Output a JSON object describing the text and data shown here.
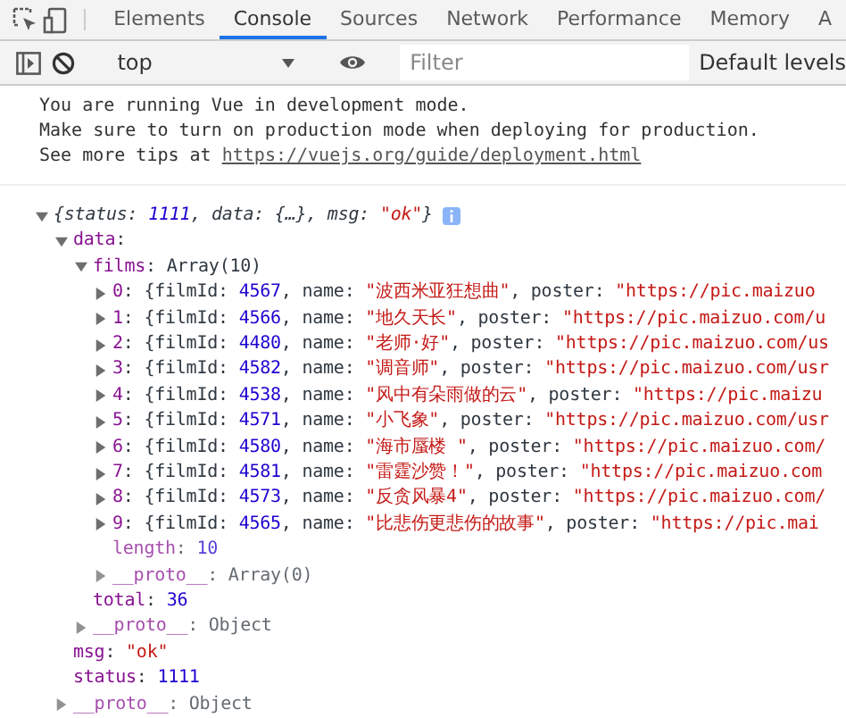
{
  "tabs": [
    {
      "label": "Elements",
      "selected": false
    },
    {
      "label": "Console",
      "selected": true
    },
    {
      "label": "Sources",
      "selected": false
    },
    {
      "label": "Network",
      "selected": false
    },
    {
      "label": "Performance",
      "selected": false
    },
    {
      "label": "Memory",
      "selected": false
    },
    {
      "label": "A",
      "selected": false
    }
  ],
  "toolbar": {
    "context": "top",
    "filter": {
      "placeholder": "Filter"
    },
    "levels": "Default levels"
  },
  "messages": [
    {
      "text": "You are running Vue in development mode."
    },
    {
      "text": "Make sure to turn on production mode when deploying for production."
    },
    {
      "text": "See more tips at ",
      "link": "https://vuejs.org/guide/deployment.html"
    }
  ],
  "tree": {
    "expanded": true,
    "italic": true,
    "info": true,
    "segments": [
      {
        "kind": "punct",
        "text": "{status: "
      },
      {
        "kind": "number",
        "text": "1111"
      },
      {
        "kind": "punct",
        "text": ", data: {…}, msg: "
      },
      {
        "kind": "string",
        "text": "\"ok\""
      },
      {
        "kind": "punct",
        "text": "}"
      }
    ],
    "children": [
      {
        "expanded": true,
        "segments": [
          {
            "kind": "key",
            "text": "data"
          },
          {
            "kind": "punct",
            "text": ":"
          }
        ],
        "children": [
          {
            "expanded": true,
            "segments": [
              {
                "kind": "key",
                "text": "films"
              },
              {
                "kind": "punct",
                "text": ": Array(10)"
              }
            ],
            "children": [
              {
                "expanded": false,
                "segments": [
                  {
                    "kind": "key",
                    "text": "0"
                  },
                  {
                    "kind": "punct",
                    "text": ": {filmId: "
                  },
                  {
                    "kind": "number",
                    "text": "4567"
                  },
                  {
                    "kind": "punct",
                    "text": ", name: "
                  },
                  {
                    "kind": "string",
                    "text": "\"波西米亚狂想曲\""
                  },
                  {
                    "kind": "punct",
                    "text": ", poster: "
                  },
                  {
                    "kind": "string",
                    "text": "\"https://pic.maizuo"
                  }
                ]
              },
              {
                "expanded": false,
                "segments": [
                  {
                    "kind": "key",
                    "text": "1"
                  },
                  {
                    "kind": "punct",
                    "text": ": {filmId: "
                  },
                  {
                    "kind": "number",
                    "text": "4566"
                  },
                  {
                    "kind": "punct",
                    "text": ", name: "
                  },
                  {
                    "kind": "string",
                    "text": "\"地久天长\""
                  },
                  {
                    "kind": "punct",
                    "text": ", poster: "
                  },
                  {
                    "kind": "string",
                    "text": "\"https://pic.maizuo.com/u"
                  }
                ]
              },
              {
                "expanded": false,
                "segments": [
                  {
                    "kind": "key",
                    "text": "2"
                  },
                  {
                    "kind": "punct",
                    "text": ": {filmId: "
                  },
                  {
                    "kind": "number",
                    "text": "4480"
                  },
                  {
                    "kind": "punct",
                    "text": ", name: "
                  },
                  {
                    "kind": "string",
                    "text": "\"老师·好\""
                  },
                  {
                    "kind": "punct",
                    "text": ", poster: "
                  },
                  {
                    "kind": "string",
                    "text": "\"https://pic.maizuo.com/us"
                  }
                ]
              },
              {
                "expanded": false,
                "segments": [
                  {
                    "kind": "key",
                    "text": "3"
                  },
                  {
                    "kind": "punct",
                    "text": ": {filmId: "
                  },
                  {
                    "kind": "number",
                    "text": "4582"
                  },
                  {
                    "kind": "punct",
                    "text": ", name: "
                  },
                  {
                    "kind": "string",
                    "text": "\"调音师\""
                  },
                  {
                    "kind": "punct",
                    "text": ", poster: "
                  },
                  {
                    "kind": "string",
                    "text": "\"https://pic.maizuo.com/usr"
                  }
                ]
              },
              {
                "expanded": false,
                "segments": [
                  {
                    "kind": "key",
                    "text": "4"
                  },
                  {
                    "kind": "punct",
                    "text": ": {filmId: "
                  },
                  {
                    "kind": "number",
                    "text": "4538"
                  },
                  {
                    "kind": "punct",
                    "text": ", name: "
                  },
                  {
                    "kind": "string",
                    "text": "\"风中有朵雨做的云\""
                  },
                  {
                    "kind": "punct",
                    "text": ", poster: "
                  },
                  {
                    "kind": "string",
                    "text": "\"https://pic.maizu"
                  }
                ]
              },
              {
                "expanded": false,
                "segments": [
                  {
                    "kind": "key",
                    "text": "5"
                  },
                  {
                    "kind": "punct",
                    "text": ": {filmId: "
                  },
                  {
                    "kind": "number",
                    "text": "4571"
                  },
                  {
                    "kind": "punct",
                    "text": ", name: "
                  },
                  {
                    "kind": "string",
                    "text": "\"小飞象\""
                  },
                  {
                    "kind": "punct",
                    "text": ", poster: "
                  },
                  {
                    "kind": "string",
                    "text": "\"https://pic.maizuo.com/usr"
                  }
                ]
              },
              {
                "expanded": false,
                "segments": [
                  {
                    "kind": "key",
                    "text": "6"
                  },
                  {
                    "kind": "punct",
                    "text": ": {filmId: "
                  },
                  {
                    "kind": "number",
                    "text": "4580"
                  },
                  {
                    "kind": "punct",
                    "text": ", name: "
                  },
                  {
                    "kind": "string",
                    "text": "\"海市蜃楼 \""
                  },
                  {
                    "kind": "punct",
                    "text": ", poster: "
                  },
                  {
                    "kind": "string",
                    "text": "\"https://pic.maizuo.com/"
                  }
                ]
              },
              {
                "expanded": false,
                "segments": [
                  {
                    "kind": "key",
                    "text": "7"
                  },
                  {
                    "kind": "punct",
                    "text": ": {filmId: "
                  },
                  {
                    "kind": "number",
                    "text": "4581"
                  },
                  {
                    "kind": "punct",
                    "text": ", name: "
                  },
                  {
                    "kind": "string",
                    "text": "\"雷霆沙赞！\""
                  },
                  {
                    "kind": "punct",
                    "text": ", poster: "
                  },
                  {
                    "kind": "string",
                    "text": "\"https://pic.maizuo.com"
                  }
                ]
              },
              {
                "expanded": false,
                "segments": [
                  {
                    "kind": "key",
                    "text": "8"
                  },
                  {
                    "kind": "punct",
                    "text": ": {filmId: "
                  },
                  {
                    "kind": "number",
                    "text": "4573"
                  },
                  {
                    "kind": "punct",
                    "text": ", name: "
                  },
                  {
                    "kind": "string",
                    "text": "\"反贪风暴4\""
                  },
                  {
                    "kind": "punct",
                    "text": ", poster: "
                  },
                  {
                    "kind": "string",
                    "text": "\"https://pic.maizuo.com/"
                  }
                ]
              },
              {
                "expanded": false,
                "segments": [
                  {
                    "kind": "key",
                    "text": "9"
                  },
                  {
                    "kind": "punct",
                    "text": ": {filmId: "
                  },
                  {
                    "kind": "number",
                    "text": "4565"
                  },
                  {
                    "kind": "punct",
                    "text": ", name: "
                  },
                  {
                    "kind": "string",
                    "text": "\"比悲伤更悲伤的故事\""
                  },
                  {
                    "kind": "punct",
                    "text": ", poster: "
                  },
                  {
                    "kind": "string",
                    "text": "\"https://pic.mai"
                  }
                ]
              },
              {
                "dim": true,
                "segments": [
                  {
                    "kind": "key",
                    "text": "length"
                  },
                  {
                    "kind": "punct",
                    "text": ": "
                  },
                  {
                    "kind": "number",
                    "text": "10"
                  }
                ]
              },
              {
                "expanded": false,
                "dim": true,
                "segments": [
                  {
                    "kind": "key",
                    "text": "__proto__"
                  },
                  {
                    "kind": "punct",
                    "text": ": Array(0)"
                  }
                ]
              }
            ]
          },
          {
            "segments": [
              {
                "kind": "key",
                "text": "total"
              },
              {
                "kind": "punct",
                "text": ": "
              },
              {
                "kind": "number",
                "text": "36"
              }
            ]
          },
          {
            "expanded": false,
            "dim": true,
            "segments": [
              {
                "kind": "key",
                "text": "__proto__"
              },
              {
                "kind": "punct",
                "text": ": Object"
              }
            ]
          }
        ]
      },
      {
        "segments": [
          {
            "kind": "key",
            "text": "msg"
          },
          {
            "kind": "punct",
            "text": ": "
          },
          {
            "kind": "string",
            "text": "\"ok\""
          }
        ]
      },
      {
        "segments": [
          {
            "kind": "key",
            "text": "status"
          },
          {
            "kind": "punct",
            "text": ": "
          },
          {
            "kind": "number",
            "text": "1111"
          }
        ]
      },
      {
        "expanded": false,
        "dim": true,
        "segments": [
          {
            "kind": "key",
            "text": "__proto__"
          },
          {
            "kind": "punct",
            "text": ": Object"
          }
        ]
      }
    ]
  }
}
